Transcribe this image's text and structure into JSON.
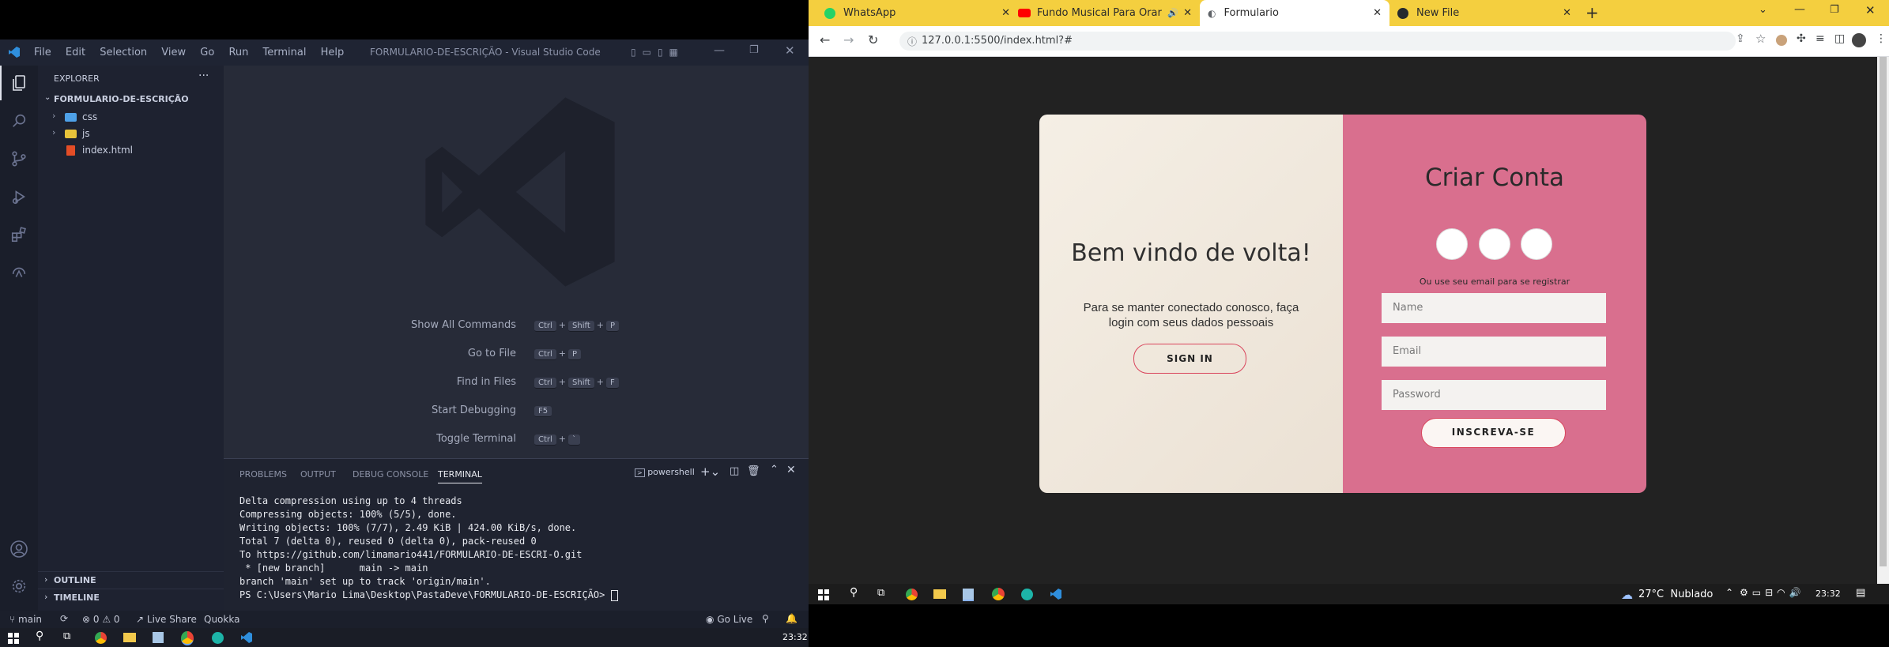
{
  "vscode": {
    "menu": [
      "File",
      "Edit",
      "Selection",
      "View",
      "Go",
      "Run",
      "Terminal",
      "Help"
    ],
    "title": "FORMULARIO-DE-ESCRIÇÃO - Visual Studio Code",
    "explorer_title": "EXPLORER",
    "folder_name": "FORMULARIO-DE-ESCRIÇÃO",
    "tree": [
      {
        "name": "css",
        "kind": "folder"
      },
      {
        "name": "js",
        "kind": "folder"
      },
      {
        "name": "index.html",
        "kind": "file"
      }
    ],
    "outline": "OUTLINE",
    "timeline": "TIMELINE",
    "commands": [
      {
        "label": "Show All Commands",
        "keys": [
          "Ctrl",
          "+",
          "Shift",
          "+",
          "P"
        ]
      },
      {
        "label": "Go to File",
        "keys": [
          "Ctrl",
          "+",
          "P"
        ]
      },
      {
        "label": "Find in Files",
        "keys": [
          "Ctrl",
          "+",
          "Shift",
          "+",
          "F"
        ]
      },
      {
        "label": "Start Debugging",
        "keys": [
          "F5"
        ]
      },
      {
        "label": "Toggle Terminal",
        "keys": [
          "Ctrl",
          "+",
          "`"
        ]
      }
    ],
    "panel_tabs": [
      "PROBLEMS",
      "OUTPUT",
      "DEBUG CONSOLE",
      "TERMINAL"
    ],
    "terminal_shell": "powershell",
    "terminal_lines": [
      "Delta compression using up to 4 threads",
      "Compressing objects: 100% (5/5), done.",
      "Writing objects: 100% (7/7), 2.49 KiB | 424.00 KiB/s, done.",
      "Total 7 (delta 0), reused 0 (delta 0), pack-reused 0",
      "To https://github.com/limamario441/FORMULARIO-DE-ESCRI-O.git",
      " * [new branch]      main -> main",
      "branch 'main' set up to track 'origin/main'.",
      "PS C:\\Users\\Mario Lima\\Desktop\\PastaDeve\\FORMULARIO-DE-ESCRIÇÃO> "
    ],
    "status": {
      "branch": "main",
      "errors": "0",
      "warnings": "0",
      "live_share": "Live Share",
      "quokka": "Quokka",
      "go_live": "Go Live"
    },
    "clock": "23:32"
  },
  "chrome": {
    "tabs": [
      {
        "title": "WhatsApp",
        "color": "#25d366"
      },
      {
        "title": "Fundo Musical Para Orar Ref",
        "color": "#ff0000"
      },
      {
        "title": "Formulario",
        "color": "#5f6368"
      },
      {
        "title": "New File",
        "color": "#24292e"
      }
    ],
    "url": "127.0.0.1:5500/index.html?#",
    "weather": "27°C  Nublado",
    "clock": "23:32"
  },
  "form": {
    "welcome_title": "Bem vindo de volta!",
    "welcome_text": "Para se manter conectado conosco, faça login com seus dados pessoais",
    "sign_in": "SIGN IN",
    "create_title": "Criar Conta",
    "social_count": 3,
    "use_email": "Ou use seu email para se registrar",
    "name_placeholder": "Name",
    "email_placeholder": "Email",
    "password_placeholder": "Password",
    "signup": "INSCREVA-SE",
    "accent": "#d96f8e"
  }
}
